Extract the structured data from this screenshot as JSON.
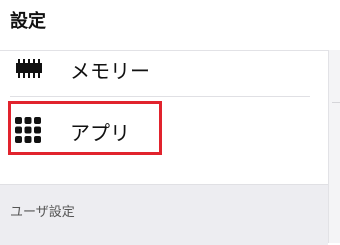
{
  "header": {
    "title": "設定"
  },
  "menu": {
    "items": [
      {
        "label": "メモリー",
        "icon": "memory-chip-icon"
      },
      {
        "label": "アプリ",
        "icon": "apps-grid-icon",
        "highlighted": true
      }
    ]
  },
  "section": {
    "label": "ユーザ設定"
  },
  "colors": {
    "highlight": "#e1232d",
    "section_bg": "#ededf1",
    "text": "#111111"
  }
}
